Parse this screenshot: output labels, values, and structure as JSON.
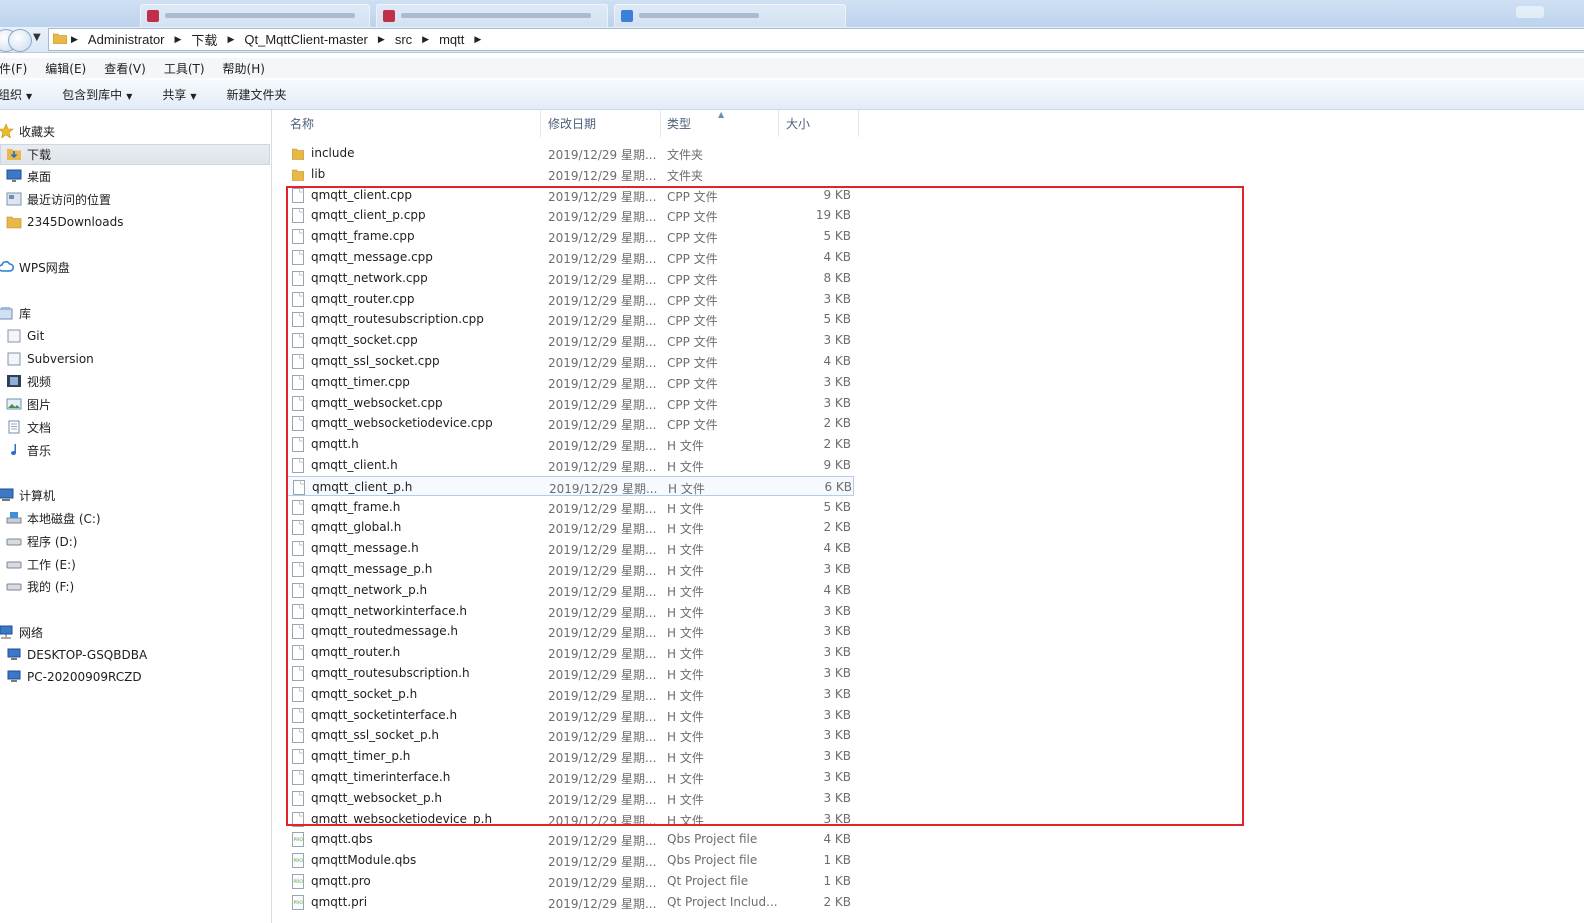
{
  "window": {
    "tabs": [
      {
        "favicon_color": "#c0304a"
      },
      {
        "favicon_color": "#c0304a"
      },
      {
        "favicon_color": "#3d7fd9"
      }
    ]
  },
  "address": {
    "breadcrumbs": [
      "Administrator",
      "下载",
      "Qt_MqttClient-master",
      "src",
      "mqtt"
    ]
  },
  "menu": [
    "件(F)",
    "编辑(E)",
    "查看(V)",
    "工具(T)",
    "帮助(H)"
  ],
  "toolbar": {
    "organize": "组织",
    "include_in_library": "包含到库中",
    "share": "共享",
    "new_folder": "新建文件夹"
  },
  "sidebar": {
    "favorites": {
      "label": "收藏夹",
      "items": [
        "下载",
        "桌面",
        "最近访问的位置",
        "2345Downloads"
      ]
    },
    "cloud": "WPS网盘",
    "libraries": {
      "label": "库",
      "items": [
        "Git",
        "Subversion",
        "视频",
        "图片",
        "文档",
        "音乐"
      ]
    },
    "computer": {
      "label": "计算机",
      "items": [
        "本地磁盘 (C:)",
        "程序 (D:)",
        "工作 (E:)",
        "我的 (F:)"
      ]
    },
    "network": {
      "label": "网络",
      "items": [
        "DESKTOP-GSQBDBA",
        "PC-20200909RCZD"
      ]
    }
  },
  "columns": {
    "name": "名称",
    "date": "修改日期",
    "type": "类型",
    "size": "大小"
  },
  "files": [
    {
      "name": "include",
      "date": "2019/12/29 星期...",
      "type": "文件夹",
      "size": "",
      "kind": "folder"
    },
    {
      "name": "lib",
      "date": "2019/12/29 星期...",
      "type": "文件夹",
      "size": "",
      "kind": "folder"
    },
    {
      "name": "qmqtt_client.cpp",
      "date": "2019/12/29 星期...",
      "type": "CPP 文件",
      "size": "9 KB",
      "kind": "file"
    },
    {
      "name": "qmqtt_client_p.cpp",
      "date": "2019/12/29 星期...",
      "type": "CPP 文件",
      "size": "19 KB",
      "kind": "file"
    },
    {
      "name": "qmqtt_frame.cpp",
      "date": "2019/12/29 星期...",
      "type": "CPP 文件",
      "size": "5 KB",
      "kind": "file"
    },
    {
      "name": "qmqtt_message.cpp",
      "date": "2019/12/29 星期...",
      "type": "CPP 文件",
      "size": "4 KB",
      "kind": "file"
    },
    {
      "name": "qmqtt_network.cpp",
      "date": "2019/12/29 星期...",
      "type": "CPP 文件",
      "size": "8 KB",
      "kind": "file"
    },
    {
      "name": "qmqtt_router.cpp",
      "date": "2019/12/29 星期...",
      "type": "CPP 文件",
      "size": "3 KB",
      "kind": "file"
    },
    {
      "name": "qmqtt_routesubscription.cpp",
      "date": "2019/12/29 星期...",
      "type": "CPP 文件",
      "size": "5 KB",
      "kind": "file"
    },
    {
      "name": "qmqtt_socket.cpp",
      "date": "2019/12/29 星期...",
      "type": "CPP 文件",
      "size": "3 KB",
      "kind": "file"
    },
    {
      "name": "qmqtt_ssl_socket.cpp",
      "date": "2019/12/29 星期...",
      "type": "CPP 文件",
      "size": "4 KB",
      "kind": "file"
    },
    {
      "name": "qmqtt_timer.cpp",
      "date": "2019/12/29 星期...",
      "type": "CPP 文件",
      "size": "3 KB",
      "kind": "file"
    },
    {
      "name": "qmqtt_websocket.cpp",
      "date": "2019/12/29 星期...",
      "type": "CPP 文件",
      "size": "3 KB",
      "kind": "file"
    },
    {
      "name": "qmqtt_websocketiodevice.cpp",
      "date": "2019/12/29 星期...",
      "type": "CPP 文件",
      "size": "2 KB",
      "kind": "file"
    },
    {
      "name": "qmqtt.h",
      "date": "2019/12/29 星期...",
      "type": "H 文件",
      "size": "2 KB",
      "kind": "file"
    },
    {
      "name": "qmqtt_client.h",
      "date": "2019/12/29 星期...",
      "type": "H 文件",
      "size": "9 KB",
      "kind": "file"
    },
    {
      "name": "qmqtt_client_p.h",
      "date": "2019/12/29 星期...",
      "type": "H 文件",
      "size": "6 KB",
      "kind": "file",
      "highlighted": true
    },
    {
      "name": "qmqtt_frame.h",
      "date": "2019/12/29 星期...",
      "type": "H 文件",
      "size": "5 KB",
      "kind": "file"
    },
    {
      "name": "qmqtt_global.h",
      "date": "2019/12/29 星期...",
      "type": "H 文件",
      "size": "2 KB",
      "kind": "file"
    },
    {
      "name": "qmqtt_message.h",
      "date": "2019/12/29 星期...",
      "type": "H 文件",
      "size": "4 KB",
      "kind": "file"
    },
    {
      "name": "qmqtt_message_p.h",
      "date": "2019/12/29 星期...",
      "type": "H 文件",
      "size": "3 KB",
      "kind": "file"
    },
    {
      "name": "qmqtt_network_p.h",
      "date": "2019/12/29 星期...",
      "type": "H 文件",
      "size": "4 KB",
      "kind": "file"
    },
    {
      "name": "qmqtt_networkinterface.h",
      "date": "2019/12/29 星期...",
      "type": "H 文件",
      "size": "3 KB",
      "kind": "file"
    },
    {
      "name": "qmqtt_routedmessage.h",
      "date": "2019/12/29 星期...",
      "type": "H 文件",
      "size": "3 KB",
      "kind": "file"
    },
    {
      "name": "qmqtt_router.h",
      "date": "2019/12/29 星期...",
      "type": "H 文件",
      "size": "3 KB",
      "kind": "file"
    },
    {
      "name": "qmqtt_routesubscription.h",
      "date": "2019/12/29 星期...",
      "type": "H 文件",
      "size": "3 KB",
      "kind": "file"
    },
    {
      "name": "qmqtt_socket_p.h",
      "date": "2019/12/29 星期...",
      "type": "H 文件",
      "size": "3 KB",
      "kind": "file"
    },
    {
      "name": "qmqtt_socketinterface.h",
      "date": "2019/12/29 星期...",
      "type": "H 文件",
      "size": "3 KB",
      "kind": "file"
    },
    {
      "name": "qmqtt_ssl_socket_p.h",
      "date": "2019/12/29 星期...",
      "type": "H 文件",
      "size": "3 KB",
      "kind": "file"
    },
    {
      "name": "qmqtt_timer_p.h",
      "date": "2019/12/29 星期...",
      "type": "H 文件",
      "size": "3 KB",
      "kind": "file"
    },
    {
      "name": "qmqtt_timerinterface.h",
      "date": "2019/12/29 星期...",
      "type": "H 文件",
      "size": "3 KB",
      "kind": "file"
    },
    {
      "name": "qmqtt_websocket_p.h",
      "date": "2019/12/29 星期...",
      "type": "H 文件",
      "size": "3 KB",
      "kind": "file"
    },
    {
      "name": "qmqtt_websocketiodevice_p.h",
      "date": "2019/12/29 星期...",
      "type": "H 文件",
      "size": "3 KB",
      "kind": "file"
    },
    {
      "name": "qmqtt.qbs",
      "date": "2019/12/29 星期...",
      "type": "Qbs Project file",
      "size": "4 KB",
      "kind": "pro"
    },
    {
      "name": "qmqttModule.qbs",
      "date": "2019/12/29 星期...",
      "type": "Qbs Project file",
      "size": "1 KB",
      "kind": "pro"
    },
    {
      "name": "qmqtt.pro",
      "date": "2019/12/29 星期...",
      "type": "Qt Project file",
      "size": "1 KB",
      "kind": "pro"
    },
    {
      "name": "qmqtt.pri",
      "date": "2019/12/29 星期...",
      "type": "Qt Project Includ...",
      "size": "2 KB",
      "kind": "pro"
    }
  ],
  "colors": {
    "annotation_box": "#e3232a",
    "folder": "#e8b949",
    "selection": "#dfe4ea"
  }
}
